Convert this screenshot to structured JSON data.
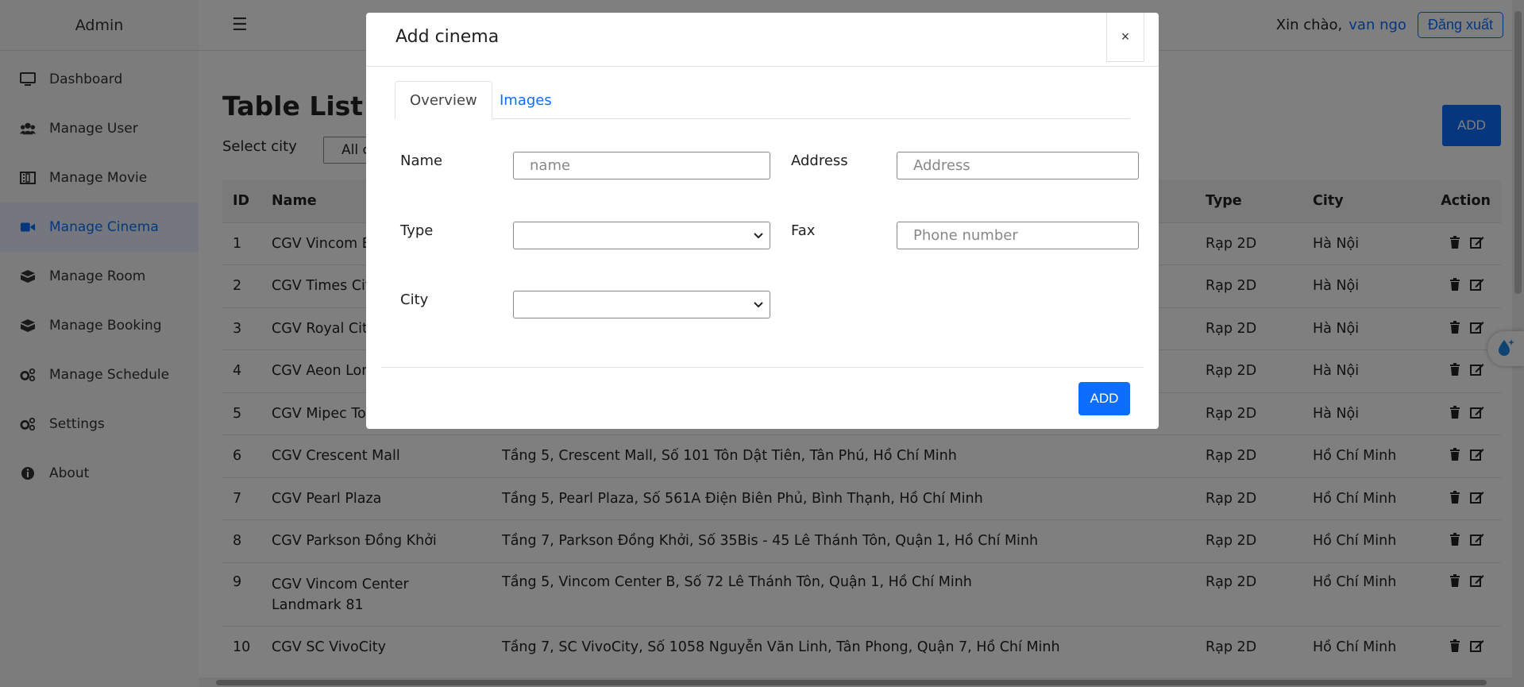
{
  "sidebar": {
    "brand": "Admin",
    "items": [
      {
        "label": "Dashboard",
        "icon": "monitor-icon"
      },
      {
        "label": "Manage User",
        "icon": "users-icon"
      },
      {
        "label": "Manage Movie",
        "icon": "film-icon"
      },
      {
        "label": "Manage Cinema",
        "icon": "video-camera-icon",
        "active": true
      },
      {
        "label": "Manage Room",
        "icon": "box-icon"
      },
      {
        "label": "Manage Booking",
        "icon": "box-icon"
      },
      {
        "label": "Manage Schedule",
        "icon": "gears-icon"
      },
      {
        "label": "Settings",
        "icon": "gears-icon"
      },
      {
        "label": "About",
        "icon": "info-circle-icon"
      }
    ]
  },
  "header": {
    "greeting": "Xin chào,",
    "username": "van ngo",
    "logout_label": "Đăng xuất"
  },
  "main": {
    "title": "Table List Ci",
    "add_label": "ADD",
    "city_label": "Select city",
    "city_selected": "All c"
  },
  "table": {
    "columns": [
      "ID",
      "Name",
      "",
      "Type",
      "City",
      "Action"
    ],
    "rows": [
      {
        "id": "1",
        "name": "CGV Vincom B",
        "address": "",
        "type": "Rạp 2D",
        "city": "Hà Nội"
      },
      {
        "id": "2",
        "name": "CGV Times Cit",
        "address": "",
        "type": "Rạp 2D",
        "city": "Hà Nội"
      },
      {
        "id": "3",
        "name": "CGV Royal Cit",
        "address": "",
        "type": "Rạp 2D",
        "city": "Hà Nội"
      },
      {
        "id": "4",
        "name": "CGV Aeon Lon",
        "address": "",
        "type": "Rạp 2D",
        "city": "Hà Nội"
      },
      {
        "id": "5",
        "name": "CGV Mipec To",
        "address": "",
        "type": "Rạp 2D",
        "city": "Hà Nội"
      },
      {
        "id": "6",
        "name": "CGV Crescent Mall",
        "address": "Tầng 5, Crescent Mall, Số 101 Tôn Dật Tiên, Tân Phú, Hồ Chí Minh",
        "type": "Rạp 2D",
        "city": "Hồ Chí Minh"
      },
      {
        "id": "7",
        "name": "CGV Pearl Plaza",
        "address": "Tầng 5, Pearl Plaza, Số 561A Điện Biên Phủ, Bình Thạnh, Hồ Chí Minh",
        "type": "Rạp 2D",
        "city": "Hồ Chí Minh"
      },
      {
        "id": "8",
        "name": "CGV Parkson Đồng Khởi",
        "address": "Tầng 7, Parkson Đồng Khởi, Số 35Bis - 45 Lê Thánh Tôn, Quận 1, Hồ Chí Minh",
        "type": "Rạp 2D",
        "city": "Hồ Chí Minh"
      },
      {
        "id": "9",
        "name": "CGV Vincom Center Landmark 81",
        "address": "Tầng 5, Vincom Center B, Số 72 Lê Thánh Tôn, Quận 1, Hồ Chí Minh",
        "type": "Rạp 2D",
        "city": "Hồ Chí Minh"
      },
      {
        "id": "10",
        "name": "CGV SC VivoCity",
        "address": "Tầng 7, SC VivoCity, Số 1058 Nguyễn Văn Linh, Tân Phong, Quận 7, Hồ Chí Minh",
        "type": "Rạp 2D",
        "city": "Hồ Chí Minh"
      }
    ]
  },
  "modal": {
    "title": "Add cinema",
    "close_label": "×",
    "tabs": [
      "Overview",
      "Images"
    ],
    "fields": {
      "name_label": "Name",
      "name_placeholder": "name",
      "address_label": "Address",
      "address_placeholder": "Address",
      "type_label": "Type",
      "fax_label": "Fax",
      "fax_placeholder": "Phone number",
      "city_label": "City"
    },
    "submit_label": "ADD"
  },
  "colors": {
    "primary": "#0d6efd",
    "overlay": "rgba(0,0,0,0.5)",
    "sidebar_bg": "#f8f9fa",
    "active_bg": "#e9f1fc"
  }
}
